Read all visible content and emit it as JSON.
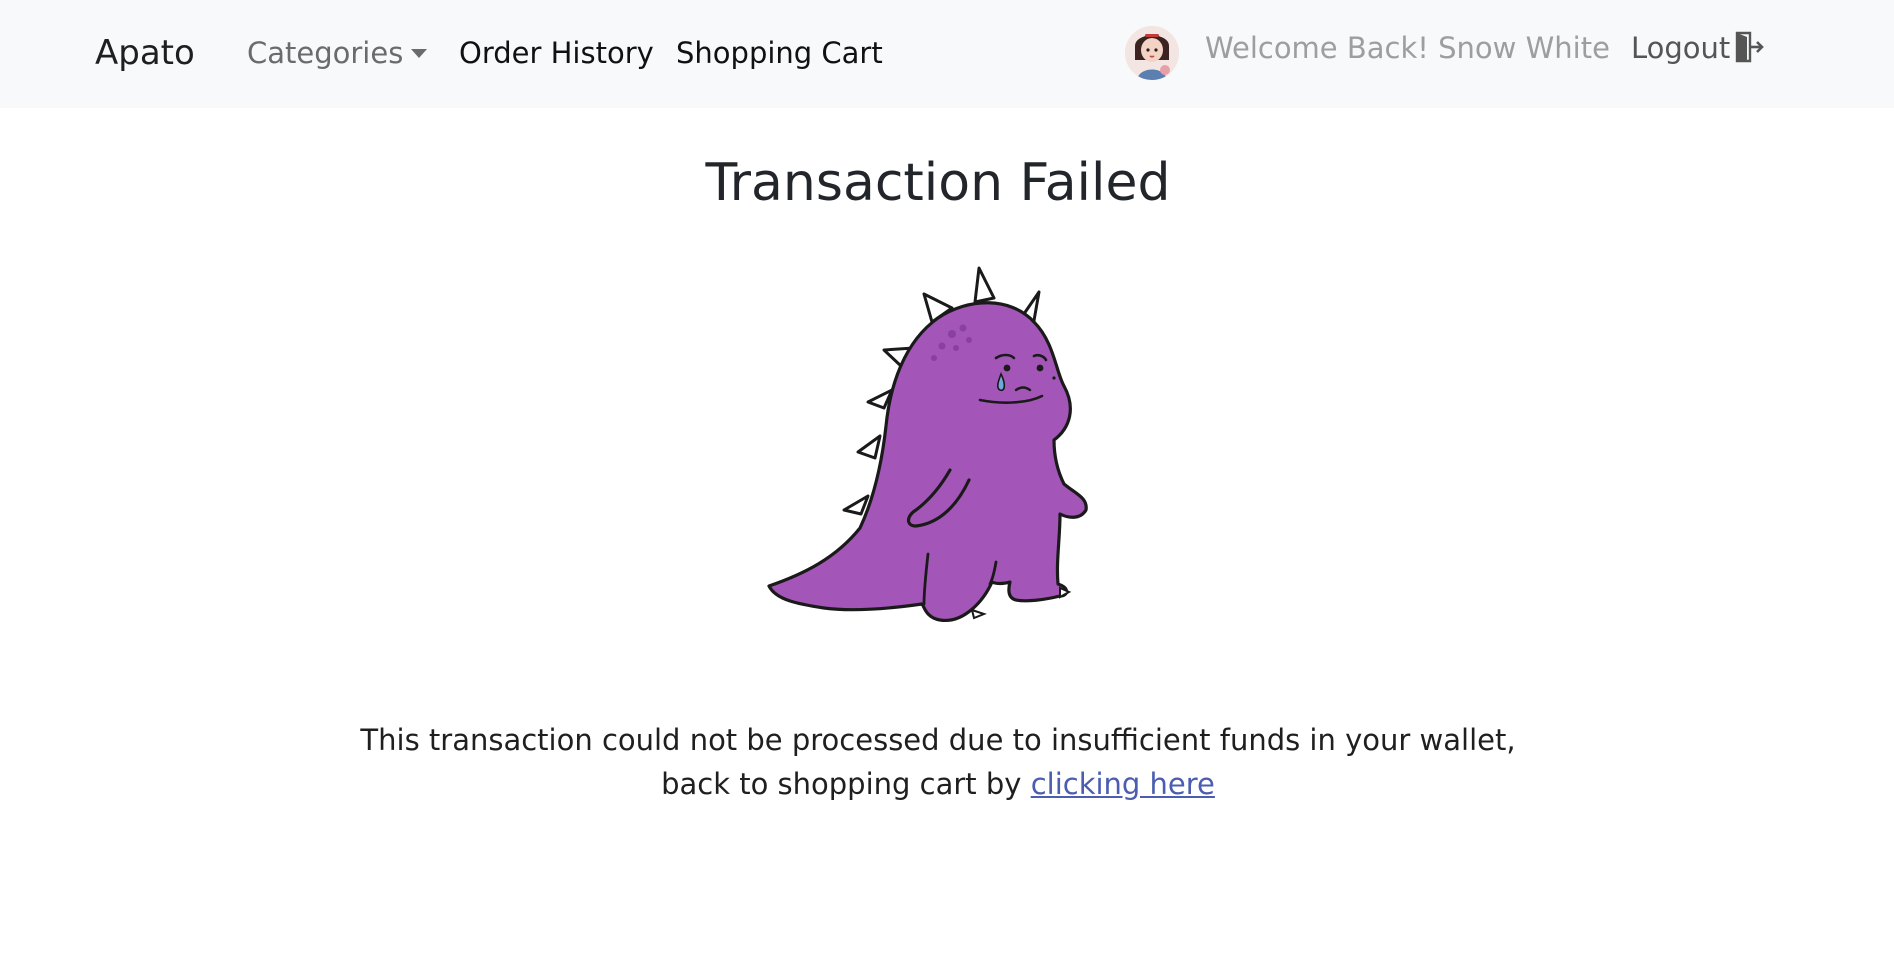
{
  "navbar": {
    "brand": "Apato",
    "categories_label": "Categories",
    "order_history_label": "Order History",
    "shopping_cart_label": "Shopping Cart",
    "welcome_text": "Welcome Back! Snow White",
    "logout_label": "Logout",
    "avatar_icon": "user-avatar",
    "logout_icon": "door-exit-icon"
  },
  "main": {
    "title": "Transaction Failed",
    "illustration": "sad-purple-dinosaur",
    "message_line1": "This transaction could not be processed due to insufficient funds in your wallet,",
    "message_line2": "back to shopping cart by",
    "link_text": "clicking here"
  },
  "colors": {
    "navbar_bg": "#f8f9fa",
    "link": "#4a5db0",
    "dino_body": "#a356b8",
    "welcome_text": "#9e9e9e"
  }
}
